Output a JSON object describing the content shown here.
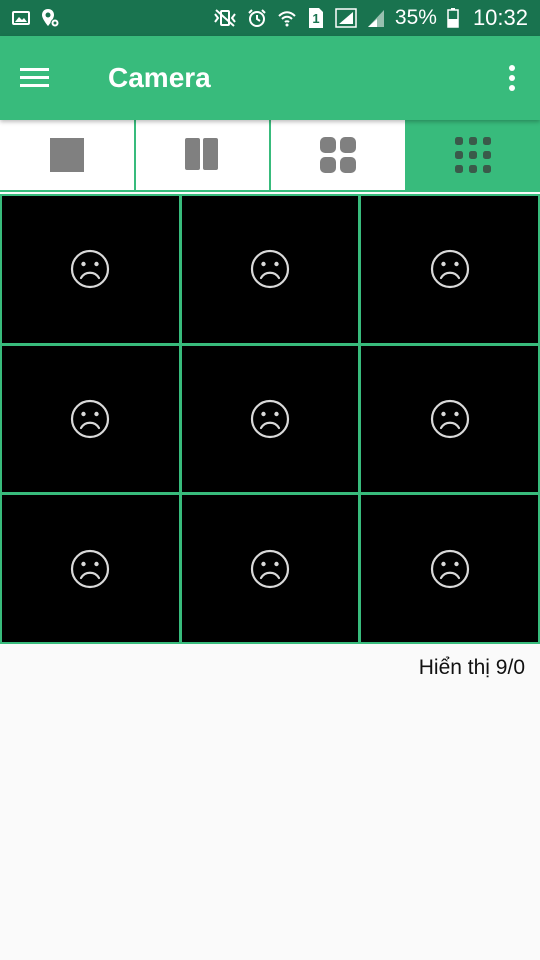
{
  "status_bar": {
    "battery": "35%",
    "time": "10:32",
    "sim_badge": "1",
    "icons": [
      "image-icon",
      "location-settings-icon",
      "vibrate-mute-icon",
      "alarm-icon",
      "wifi-icon",
      "sim-icon",
      "signal-icon",
      "battery-icon"
    ]
  },
  "app_bar": {
    "title": "Camera",
    "menu_icon": "hamburger-menu-icon",
    "overflow_icon": "more-vert-icon"
  },
  "layout_tabs": [
    {
      "icon": "single-view-icon",
      "active": false
    },
    {
      "icon": "two-column-view-icon",
      "active": false
    },
    {
      "icon": "four-grid-view-icon",
      "active": false
    },
    {
      "icon": "nine-grid-view-icon",
      "active": true
    }
  ],
  "camera_grid": {
    "rows": 3,
    "columns": 3,
    "cell_icon": "sad-face-icon"
  },
  "footer": {
    "display_count": "Hiển thị 9/0"
  },
  "colors": {
    "accent": "#38bb7c",
    "status_bar": "#19734f",
    "tab_icon": "#808080",
    "tab_icon_active": "#3a5a4a",
    "cell_background": "#000000",
    "cell_icon": "#d9d9d9"
  }
}
